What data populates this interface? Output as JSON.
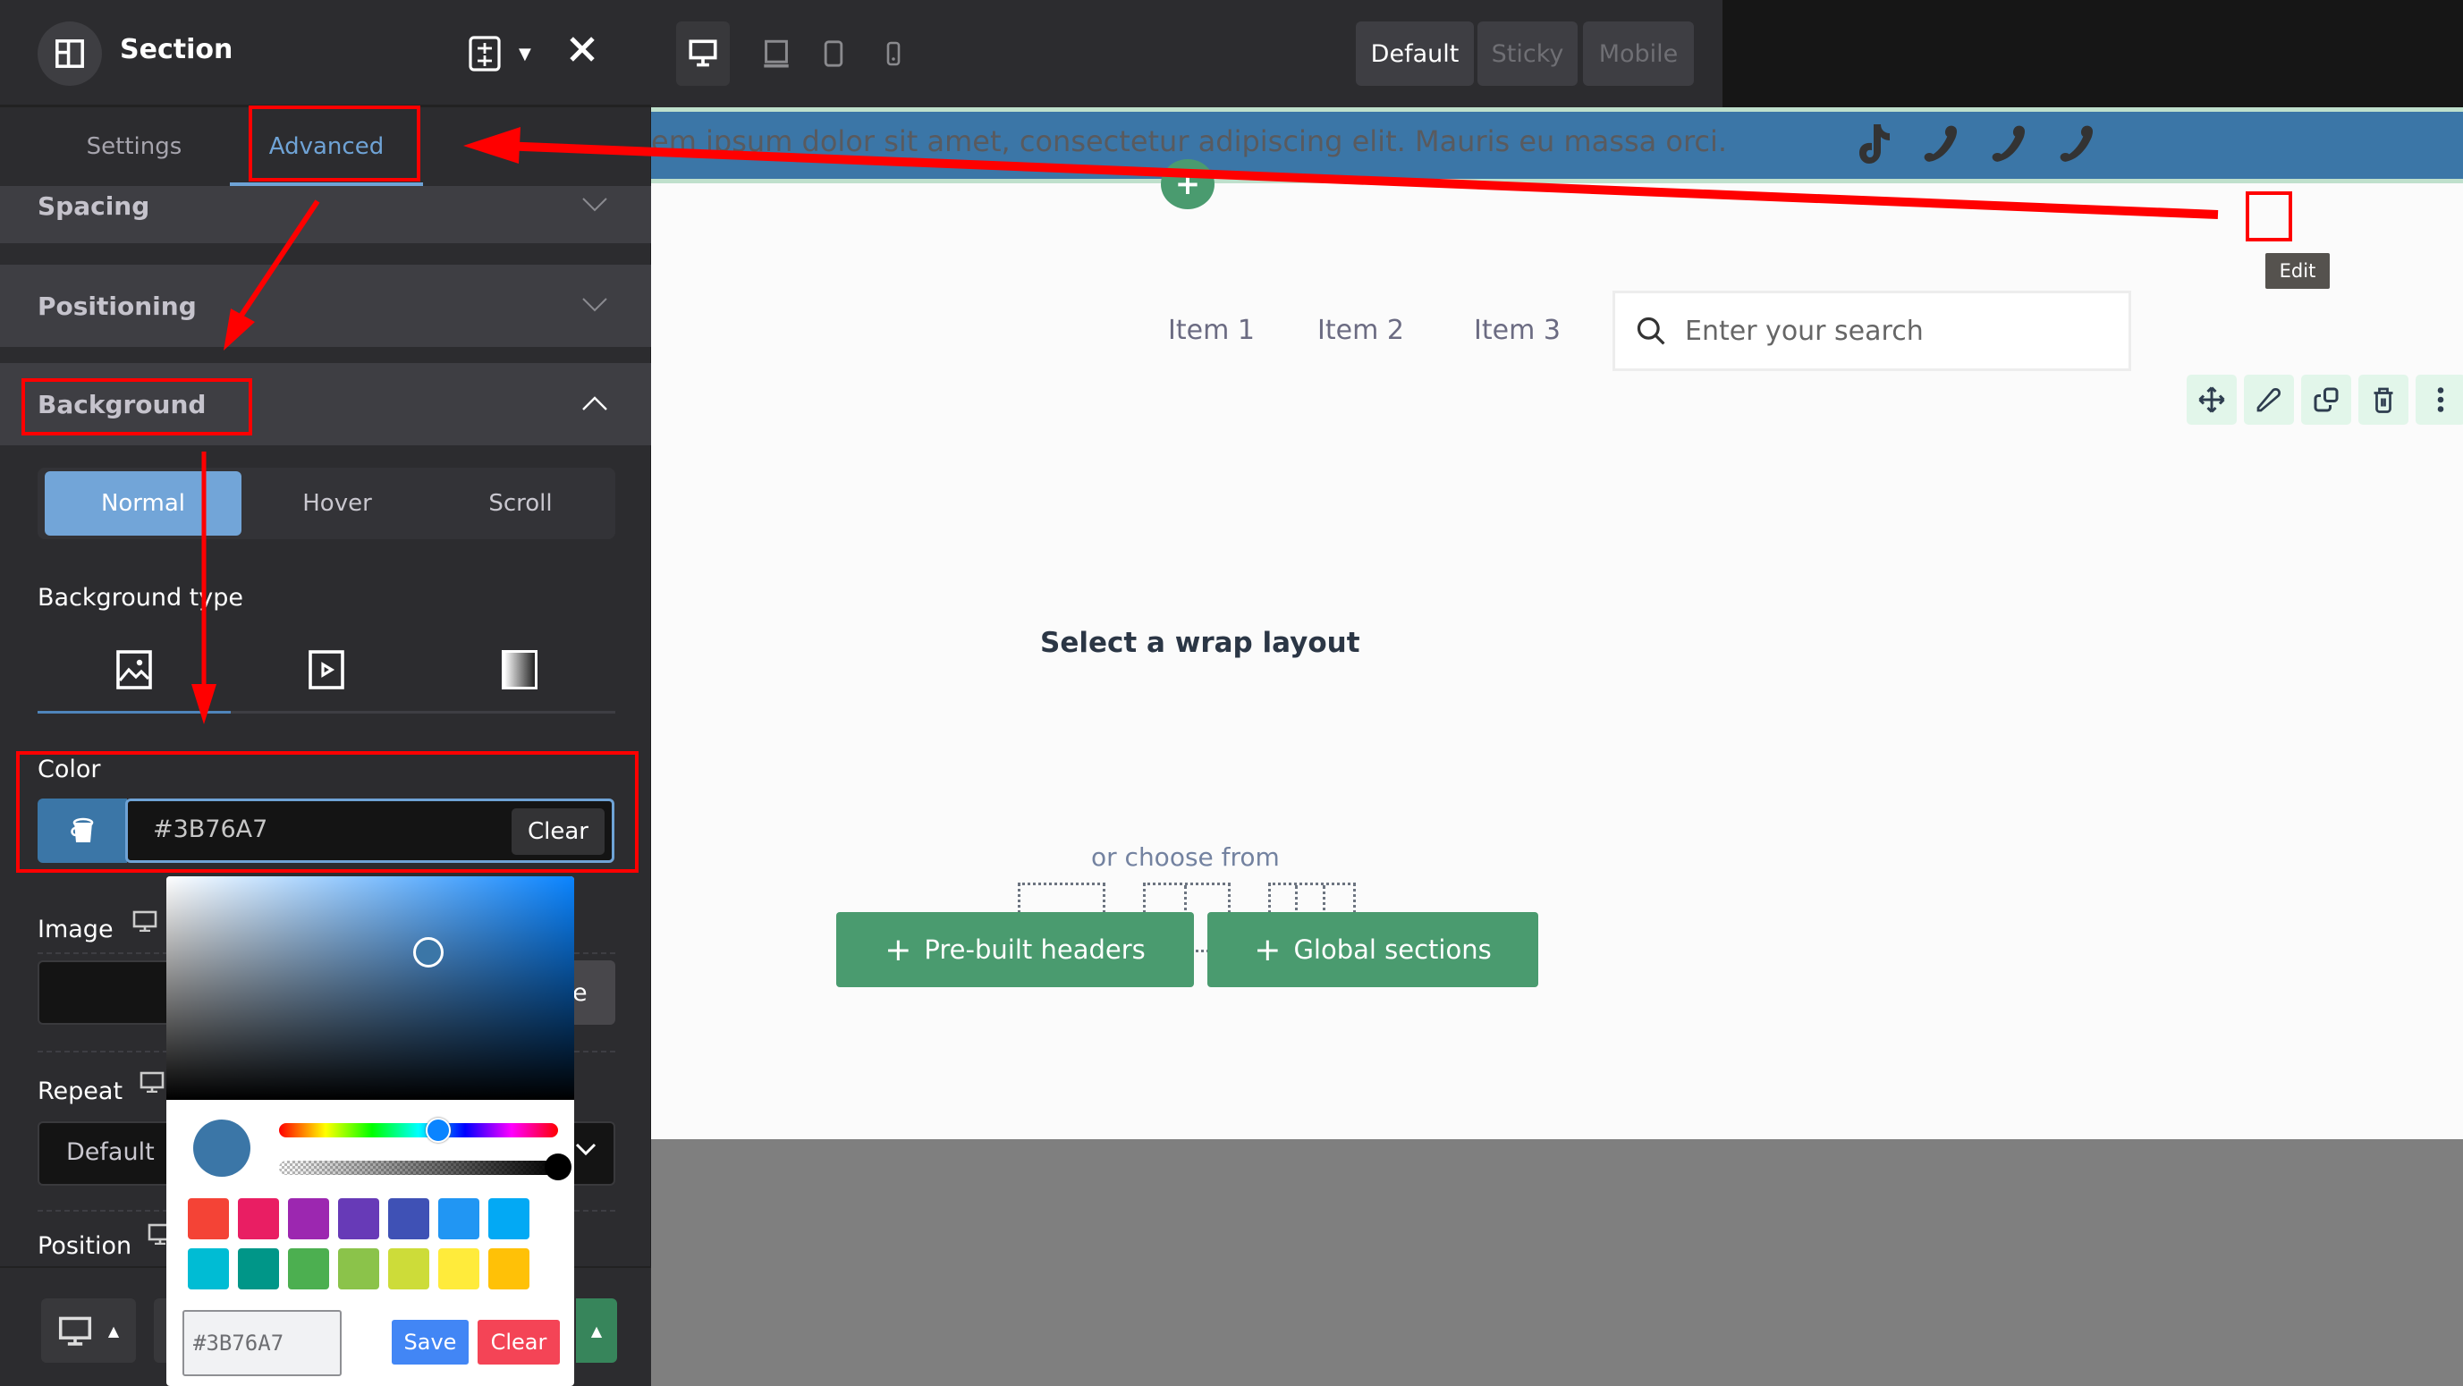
{
  "panel": {
    "title": "Section",
    "tabs": [
      {
        "label": "Settings",
        "active": false
      },
      {
        "label": "Advanced",
        "active": true
      }
    ],
    "accordions": [
      {
        "label": "Spacing",
        "expanded": false
      },
      {
        "label": "Positioning",
        "expanded": false
      },
      {
        "label": "Background",
        "expanded": true
      }
    ],
    "state_tabs": [
      {
        "label": "Normal",
        "active": true
      },
      {
        "label": "Hover",
        "active": false
      },
      {
        "label": "Scroll",
        "active": false
      }
    ],
    "background_type_label": "Background type",
    "background_types": [
      "image-icon",
      "video-icon",
      "gradient-icon"
    ],
    "color": {
      "label": "Color",
      "value": "#3B76A7",
      "clear_label": "Clear"
    },
    "image": {
      "label": "Image",
      "button_partial": "e"
    },
    "repeat": {
      "label": "Repeat",
      "value": "Default"
    },
    "position": {
      "label": "Position"
    }
  },
  "picker": {
    "current_color": "#3B76A7",
    "hex_value": "#3B76A7",
    "save_label": "Save",
    "clear_label": "Clear",
    "hue_fraction": 0.57,
    "alpha_fraction": 1.0,
    "swatches": [
      "#f44336",
      "#e91e63",
      "#9c27b0",
      "#673ab7",
      "#3f51b5",
      "#2196f3",
      "#03a9f4",
      "#00bcd4",
      "#009688",
      "#4caf50",
      "#8bc34a",
      "#cddc39",
      "#ffeb3b",
      "#ffc107"
    ]
  },
  "toolbar": {
    "devices": [
      "desktop-icon",
      "laptop-icon",
      "tablet-icon",
      "mobile-icon"
    ],
    "modes": [
      {
        "label": "Default",
        "active": true
      },
      {
        "label": "Sticky",
        "active": false
      },
      {
        "label": "Mobile",
        "active": false
      }
    ]
  },
  "canvas": {
    "band_text": "em ipsum dolor sit amet, consectetur adipiscing elit. Mauris eu massa orci.",
    "band_icons": [
      "tiktok-icon",
      "phone-icon",
      "phone-icon",
      "phone-icon"
    ],
    "band_color": "#3B76A7",
    "nav_items": [
      "Item 1",
      "Item 2",
      "Item 3"
    ],
    "search_placeholder": "Enter your search",
    "wrap_title": "Select a wrap layout",
    "or_text": "or choose from",
    "prebuilt_label": "Pre-built headers",
    "global_label": "Global sections",
    "controls": [
      "move-icon",
      "edit-icon",
      "duplicate-icon",
      "trash-icon",
      "more-icon"
    ],
    "tooltip": "Edit"
  }
}
